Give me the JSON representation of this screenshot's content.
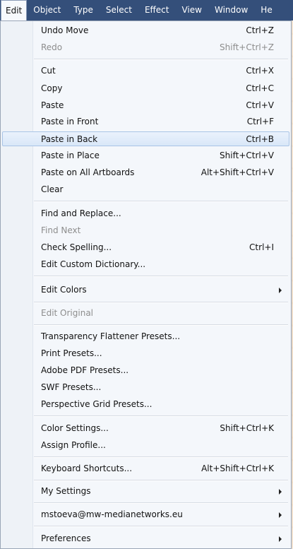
{
  "menubar": {
    "items": [
      "Edit",
      "Object",
      "Type",
      "Select",
      "Effect",
      "View",
      "Window",
      "He"
    ],
    "active": "Edit"
  },
  "menu": {
    "items": [
      {
        "label": "Undo Move",
        "shortcut": "Ctrl+Z",
        "enabled": true
      },
      {
        "label": "Redo",
        "shortcut": "Shift+Ctrl+Z",
        "enabled": false
      },
      {
        "label": "Cut",
        "shortcut": "Ctrl+X",
        "enabled": true
      },
      {
        "label": "Copy",
        "shortcut": "Ctrl+C",
        "enabled": true
      },
      {
        "label": "Paste",
        "shortcut": "Ctrl+V",
        "enabled": true
      },
      {
        "label": "Paste in Front",
        "shortcut": "Ctrl+F",
        "enabled": true
      },
      {
        "label": "Paste in Back",
        "shortcut": "Ctrl+B",
        "enabled": true,
        "highlighted": true
      },
      {
        "label": "Paste in Place",
        "shortcut": "Shift+Ctrl+V",
        "enabled": true
      },
      {
        "label": "Paste on All Artboards",
        "shortcut": "Alt+Shift+Ctrl+V",
        "enabled": true
      },
      {
        "label": "Clear",
        "shortcut": "",
        "enabled": true
      },
      {
        "label": "Find and Replace...",
        "shortcut": "",
        "enabled": true
      },
      {
        "label": "Find Next",
        "shortcut": "",
        "enabled": false
      },
      {
        "label": "Check Spelling...",
        "shortcut": "Ctrl+I",
        "enabled": true
      },
      {
        "label": "Edit Custom Dictionary...",
        "shortcut": "",
        "enabled": true
      },
      {
        "label": "Edit Colors",
        "shortcut": "",
        "enabled": true,
        "submenu": true
      },
      {
        "label": "Edit Original",
        "shortcut": "",
        "enabled": false
      },
      {
        "label": "Transparency Flattener Presets...",
        "shortcut": "",
        "enabled": true
      },
      {
        "label": "Print Presets...",
        "shortcut": "",
        "enabled": true
      },
      {
        "label": "Adobe PDF Presets...",
        "shortcut": "",
        "enabled": true
      },
      {
        "label": "SWF Presets...",
        "shortcut": "",
        "enabled": true
      },
      {
        "label": "Perspective Grid Presets...",
        "shortcut": "",
        "enabled": true
      },
      {
        "label": "Color Settings...",
        "shortcut": "Shift+Ctrl+K",
        "enabled": true
      },
      {
        "label": "Assign Profile...",
        "shortcut": "",
        "enabled": true
      },
      {
        "label": "Keyboard Shortcuts...",
        "shortcut": "Alt+Shift+Ctrl+K",
        "enabled": true
      },
      {
        "label": "My Settings",
        "shortcut": "",
        "enabled": true,
        "submenu": true
      },
      {
        "label": "mstoeva@mw-medianetworks.eu",
        "shortcut": "",
        "enabled": true,
        "submenu": true
      },
      {
        "label": "Preferences",
        "shortcut": "",
        "enabled": true,
        "submenu": true
      }
    ]
  },
  "colors": {
    "menubar_bg": "#344f7a",
    "highlight": "#d9e7f8",
    "disabled_text": "#8d8d8d"
  }
}
